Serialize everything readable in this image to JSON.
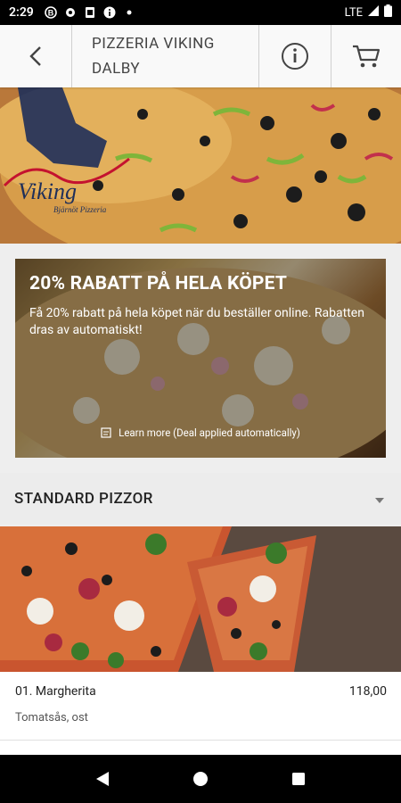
{
  "status_bar": {
    "time": "2:29",
    "network": "LTE"
  },
  "header": {
    "title_line1": "PIZZERIA VIKING",
    "title_line2": "DALBY"
  },
  "hero": {
    "logo_text": "Viking",
    "logo_sub": "Bjärnöt Pizzeria"
  },
  "promo": {
    "heading": "20% RABATT PÅ HELA KÖPET",
    "description": "Få 20% rabatt på hela köpet när du beställer online. Rabatten dras av automatiskt!",
    "learn_more": "Learn more (Deal applied automatically)"
  },
  "category": {
    "label": "STANDARD PIZZOR"
  },
  "product": {
    "name": "01. Margherita",
    "price": "118,00",
    "description": "Tomatsås, ost"
  },
  "colors": {
    "status_bg": "#000000",
    "header_bg": "#fafafa",
    "category_bg": "#ececec",
    "nav_bg": "#000000"
  }
}
